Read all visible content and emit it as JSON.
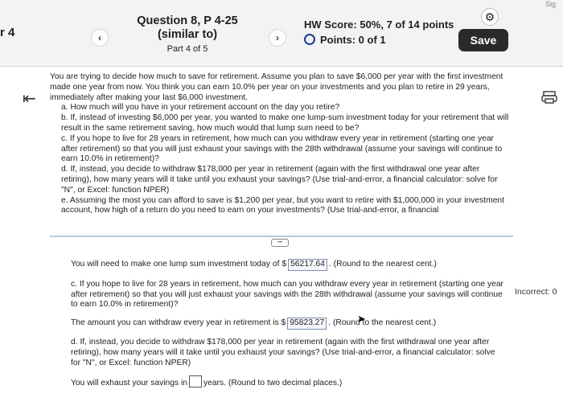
{
  "header": {
    "chapter_label": "r 4",
    "question_title": "Question 8, P 4-25 (similar to)",
    "part": "Part 4 of 5",
    "hw_score": "HW Score: 50%, 7 of 14 points",
    "points": "Points: 0 of 1",
    "save_label": "Save",
    "prev_icon": "chevron-left-icon",
    "next_icon": "chevron-right-icon",
    "settings_icon": "gear-icon",
    "corner_text": "Sig"
  },
  "problem": {
    "intro": "You are trying to decide how much to save for retirement. Assume you plan to save $6,000 per year with the first investment made one year from now. You think you can earn 10.0% per year on your investments and you plan to retire in 29 years, immediately after making your last $6,000 investment.",
    "a": "a. How much will you have in your retirement account on the day you retire?",
    "b": "b. If, instead of investing $6,000 per year, you wanted to make one lump-sum investment today for your retirement that will result in the same retirement saving, how much would that lump sum need to be?",
    "c": "c. If you hope to live for 28 years in retirement, how much can you withdraw every year in retirement (starting one year after retirement) so that you will just exhaust your savings with the 28th withdrawal (assume your savings will continue to earn 10.0% in retirement)?",
    "d": "d. If, instead, you decide to withdraw $178,000 per year in retirement (again with the first withdrawal one year after retiring), how many years will it take until you exhaust your savings? (Use trial-and-error, a financial calculator: solve for \"N\", or Excel: function NPER)",
    "e": "e. Assuming the most you can afford to save is $1,200 per year, but you want to retire with $1,000,000 in your investment account, how high of a return do you need to earn on your investments? (Use trial-and-error, a financial"
  },
  "answers": {
    "b_prefix": "You will need to make one lump sum investment today of $",
    "b_value": "56217.64",
    "b_suffix": ". (Round to the nearest cent.)",
    "c_question": "c. If you hope to live for 28 years in retirement, how much can you withdraw every year in retirement (starting one year after retirement) so that you will just exhaust your savings with the 28th withdrawal (assume your savings will continue to earn 10.0% in retirement)?",
    "c_prefix": "The amount you can withdraw every year in retirement is $",
    "c_value": "95823.27",
    "c_suffix": ". (Round to the nearest cent.)",
    "d_question": "d. If, instead, you decide to withdraw $178,000 per year in retirement (again with the first withdrawal one year after retiring), how many years will it take until you exhaust your savings? (Use trial-and-error, a financial calculator: solve for \"N\", or Excel: function NPER)",
    "d_prefix": "You will exhaust your savings in",
    "d_suffix": "years. (Round to two decimal places.)",
    "incorrect_label": "Incorrect: 0"
  },
  "icons": {
    "back": "back-to-start-icon",
    "print": "print-icon",
    "cursor": "mouse-cursor-icon"
  }
}
